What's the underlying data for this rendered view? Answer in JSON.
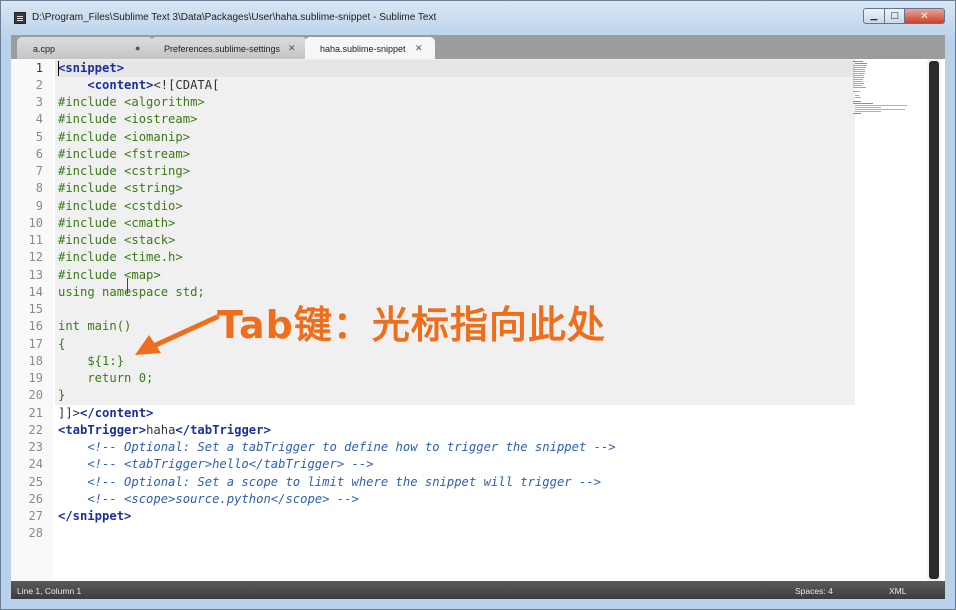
{
  "window": {
    "title": "D:\\Program_Files\\Sublime Text 3\\Data\\Packages\\User\\haha.sublime-snippet - Sublime Text",
    "controls": {
      "minimize": "▁",
      "maximize": "□",
      "close": "✕"
    }
  },
  "tabs": [
    {
      "label": "a.cpp",
      "close": "●",
      "active": false
    },
    {
      "label": "Preferences.sublime-settings",
      "close": "✕",
      "active": false
    },
    {
      "label": "haha.sublime-snippet",
      "close": "✕",
      "active": true
    }
  ],
  "editor": {
    "line_numbers": [
      "1",
      "2",
      "3",
      "4",
      "5",
      "6",
      "7",
      "8",
      "9",
      "10",
      "11",
      "12",
      "13",
      "14",
      "15",
      "16",
      "17",
      "18",
      "19",
      "20",
      "21",
      "22",
      "23",
      "24",
      "25",
      "26",
      "27",
      "28"
    ]
  },
  "code": {
    "l1_open": "<snippet>",
    "l2_indent": "    ",
    "l2_tag": "<content>",
    "l2_cdata": "<![CDATA[",
    "l3": "#include <algorithm>",
    "l4": "#include <iostream>",
    "l5": "#include <iomanip>",
    "l6": "#include <fstream>",
    "l7": "#include <cstring>",
    "l8": "#include <string>",
    "l9": "#include <cstdio>",
    "l10": "#include <cmath>",
    "l11": "#include <stack>",
    "l12": "#include <time.h>",
    "l13": "#include <map>",
    "l14": "using namespace std;",
    "l16": "int main()",
    "l17": "{",
    "l18": "    ${1:}",
    "l19": "    return 0;",
    "l20": "}",
    "l21_cdata": "]]>",
    "l21_tag": "</content>",
    "l22_open": "<tabTrigger>",
    "l22_val": "haha",
    "l22_close": "</tabTrigger>",
    "l23": "    <!-- Optional: Set a tabTrigger to define how to trigger the snippet -->",
    "l24": "    <!-- <tabTrigger>hello</tabTrigger> -->",
    "l25": "    <!-- Optional: Set a scope to limit where the snippet will trigger -->",
    "l26": "    <!-- <scope>source.python</scope> -->",
    "l27": "</snippet>"
  },
  "annotation": {
    "text": "Tab键：光标指向此处",
    "color": "#ef6e1d"
  },
  "status": {
    "position": "Line 1, Column 1",
    "spaces": "Spaces: 4",
    "syntax": "XML"
  },
  "colors": {
    "tag": "#1a2fa0",
    "include": "#3a7a17",
    "comment": "#2e5fb5",
    "accent": "#ef6e1d"
  }
}
